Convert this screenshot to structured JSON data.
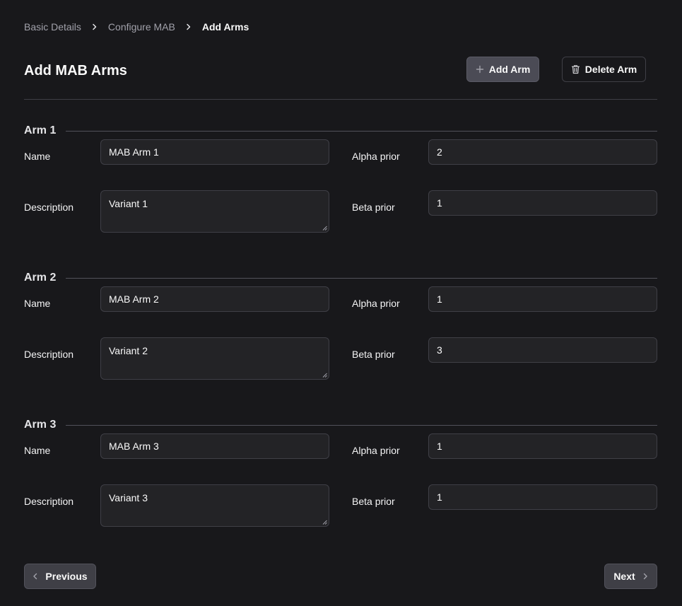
{
  "breadcrumb": {
    "items": [
      "Basic Details",
      "Configure MAB",
      "Add Arms"
    ]
  },
  "header": {
    "title": "Add MAB Arms",
    "add_label": "Add Arm",
    "delete_label": "Delete Arm"
  },
  "labels": {
    "name": "Name",
    "description": "Description",
    "alpha": "Alpha prior",
    "beta": "Beta prior"
  },
  "arms": [
    {
      "title": "Arm 1",
      "name": "MAB Arm 1",
      "description": "Variant 1",
      "alpha": "2",
      "beta": "1"
    },
    {
      "title": "Arm 2",
      "name": "MAB Arm 2",
      "description": "Variant 2",
      "alpha": "1",
      "beta": "3"
    },
    {
      "title": "Arm 3",
      "name": "MAB Arm 3",
      "description": "Variant 3",
      "alpha": "1",
      "beta": "1"
    }
  ],
  "footer": {
    "previous_label": "Previous",
    "next_label": "Next"
  },
  "icons": {
    "breadcrumb_separator": "chevron-right-icon",
    "add": "plus-icon",
    "delete": "trash-icon",
    "previous": "chevron-left-icon",
    "next": "chevron-right-icon"
  }
}
